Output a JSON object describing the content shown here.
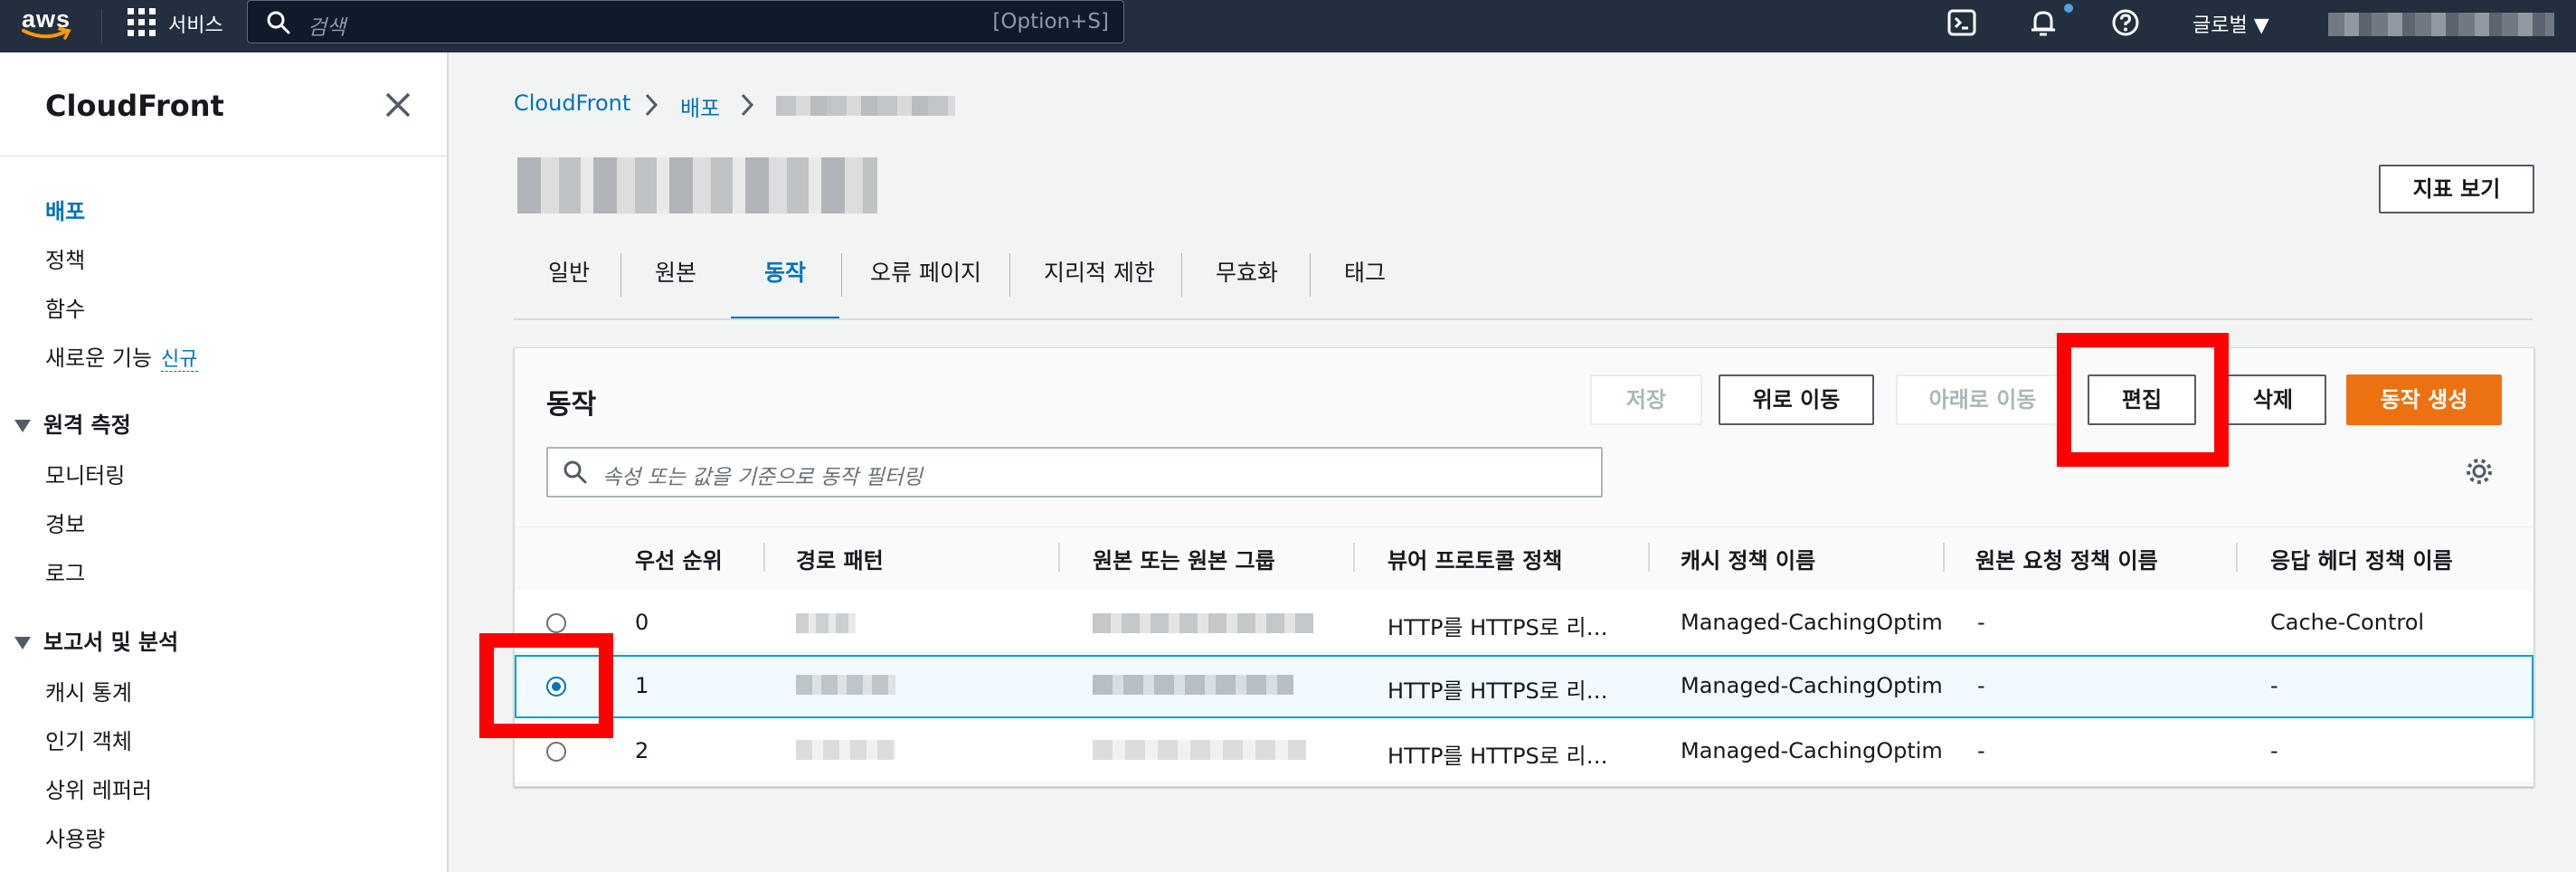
{
  "topbar": {
    "logo": "aws",
    "services": "서비스",
    "search_placeholder": "검색",
    "search_shortcut": "[Option+S]",
    "region": "글로벌 ▼",
    "icons": [
      "cloudshell-icon",
      "notifications-icon",
      "help-icon"
    ]
  },
  "sidebar": {
    "title": "CloudFront",
    "items_top": [
      "배포",
      "정책",
      "함수",
      "새로운 기능"
    ],
    "new_badge": "신규",
    "section_telemetry": "원격 측정",
    "telemetry_items": [
      "모니터링",
      "경보",
      "로그"
    ],
    "section_reports": "보고서 및 분석",
    "report_items": [
      "캐시 통계",
      "인기 객체",
      "상위 레퍼러",
      "사용량"
    ]
  },
  "breadcrumb": [
    "CloudFront",
    "배포"
  ],
  "page": {
    "view_metrics": "지표 보기",
    "tabs": [
      "일반",
      "원본",
      "동작",
      "오류 페이지",
      "지리적 제한",
      "무효화",
      "태그"
    ],
    "active_tab": "동작"
  },
  "behaviors": {
    "title": "동작",
    "buttons": {
      "save": "저장",
      "move_up": "위로 이동",
      "move_down": "아래로 이동",
      "edit": "편집",
      "delete": "삭제",
      "create": "동작 생성"
    },
    "filter_placeholder": "속성 또는 값을 기준으로 동작 필터링",
    "columns": [
      "우선 순위",
      "경로 패턴",
      "원본 또는 원본 그룹",
      "뷰어 프로토콜 정책",
      "캐시 정책 이름",
      "원본 요청 정책 이름",
      "응답 헤더 정책 이름"
    ],
    "rows": [
      {
        "priority": "0",
        "viewer": "HTTP를 HTTPS로 리…",
        "cache": "Managed-CachingOptimiz",
        "origin_request": "-",
        "response_headers": "Cache-Control",
        "selected": false
      },
      {
        "priority": "1",
        "viewer": "HTTP를 HTTPS로 리…",
        "cache": "Managed-CachingOptimiz",
        "origin_request": "-",
        "response_headers": "-",
        "selected": true
      },
      {
        "priority": "2",
        "viewer": "HTTP를 HTTPS로 리…",
        "cache": "Managed-CachingOptimiz",
        "origin_request": "-",
        "response_headers": "-",
        "selected": false
      }
    ]
  },
  "colors": {
    "topbar": "#232f3e",
    "link": "#0073bb",
    "primary_button": "#ec7211",
    "highlight": "#ff0000"
  }
}
